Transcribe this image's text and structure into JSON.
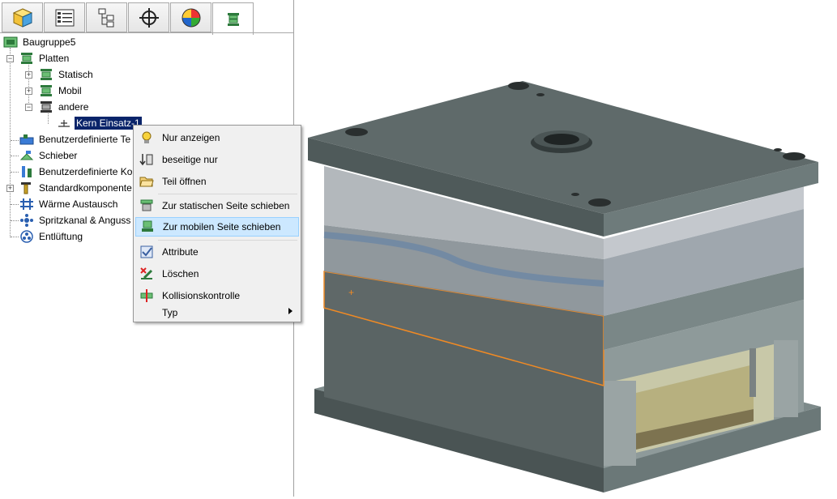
{
  "tabs": [
    {
      "icon": "part-cube-icon"
    },
    {
      "icon": "property-list-icon"
    },
    {
      "icon": "tree-structure-icon"
    },
    {
      "icon": "crosshair-icon"
    },
    {
      "icon": "color-wheel-icon"
    },
    {
      "icon": "mold-assembly-icon",
      "active": true
    }
  ],
  "tree": {
    "root": "Baugruppe5",
    "platten": "Platten",
    "statisch": "Statisch",
    "mobil": "Mobil",
    "andere": "andere",
    "kern_einsatz": "Kern Einsatz-1",
    "benutzer_teile": "Benutzerdefinierte Te",
    "schieber": "Schieber",
    "benutzer_ko": "Benutzerdefinierte Ko",
    "standardkomponente": "Standardkomponente",
    "waerme": "Wärme Austausch",
    "spritzkanal": "Spritzkanal & Anguss",
    "entlueftung": "Entlüftung"
  },
  "context_menu": {
    "nur_anzeigen": "Nur anzeigen",
    "beseitige_nur": "beseitige nur",
    "teil_oeffnen": "Teil öffnen",
    "statische_seite": "Zur statischen Seite schieben",
    "mobile_seite": "Zur mobilen Seite schieben",
    "attribute": "Attribute",
    "loeschen": "Löschen",
    "kollision": "Kollisionskontrolle",
    "typ": "Typ"
  },
  "colors": {
    "selection": "#0a246a",
    "menu_highlight": "#cce8ff",
    "mold_top": "#5f6a6a",
    "selected_plate_outline": "#f08a24"
  }
}
